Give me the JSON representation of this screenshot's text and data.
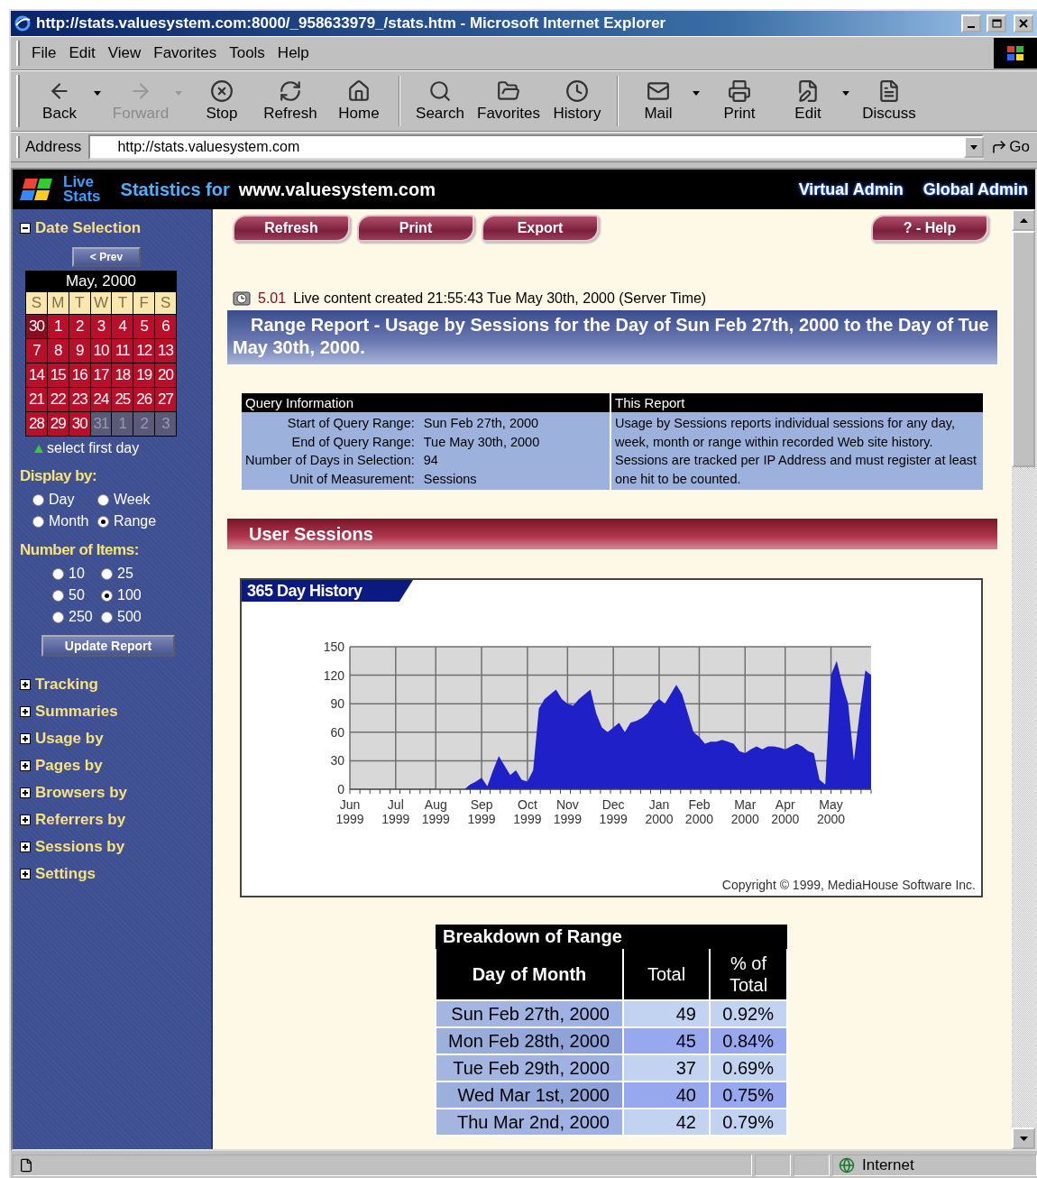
{
  "window": {
    "title": "http://stats.valuesystem.com:8000/_958633979_/stats.htm - Microsoft Internet Explorer"
  },
  "menu": [
    "File",
    "Edit",
    "View",
    "Favorites",
    "Tools",
    "Help"
  ],
  "toolbar_groups": [
    [
      {
        "label": "Back",
        "dropdown": true,
        "disabled": false
      },
      {
        "label": "Forward",
        "dropdown": true,
        "disabled": true
      },
      {
        "label": "Stop",
        "dropdown": false,
        "disabled": false
      },
      {
        "label": "Refresh",
        "dropdown": false,
        "disabled": false
      },
      {
        "label": "Home",
        "dropdown": false,
        "disabled": false
      }
    ],
    [
      {
        "label": "Search",
        "dropdown": false,
        "disabled": false
      },
      {
        "label": "Favorites",
        "dropdown": false,
        "disabled": false
      },
      {
        "label": "History",
        "dropdown": false,
        "disabled": false
      }
    ],
    [
      {
        "label": "Mail",
        "dropdown": true,
        "disabled": false
      },
      {
        "label": "Print",
        "dropdown": false,
        "disabled": false
      },
      {
        "label": "Edit",
        "dropdown": true,
        "disabled": false
      },
      {
        "label": "Discuss",
        "dropdown": false,
        "disabled": false
      }
    ]
  ],
  "address": {
    "label": "Address",
    "value": "http://stats.valuesystem.com",
    "go": "Go"
  },
  "header": {
    "logo": [
      "Live",
      "Stats"
    ],
    "prefix": "Statistics for",
    "site": "www.valuesystem.com",
    "links": [
      "Virtual Admin",
      "Global Admin"
    ]
  },
  "sidebar": {
    "date_selection": {
      "title": "Date Selection",
      "expanded": true,
      "prev": "< Prev",
      "calendar": {
        "title": "May, 2000",
        "weekdays": [
          "S",
          "M",
          "T",
          "W",
          "T",
          "F",
          "S"
        ],
        "weeks": [
          [
            {
              "day": "30",
              "kind": "other"
            },
            {
              "day": "1",
              "kind": "day"
            },
            {
              "day": "2",
              "kind": "day"
            },
            {
              "day": "3",
              "kind": "day"
            },
            {
              "day": "4",
              "kind": "day"
            },
            {
              "day": "5",
              "kind": "day"
            },
            {
              "day": "6",
              "kind": "day"
            }
          ],
          [
            {
              "day": "7",
              "kind": "day"
            },
            {
              "day": "8",
              "kind": "day"
            },
            {
              "day": "9",
              "kind": "day"
            },
            {
              "day": "10",
              "kind": "day"
            },
            {
              "day": "11",
              "kind": "day"
            },
            {
              "day": "12",
              "kind": "day"
            },
            {
              "day": "13",
              "kind": "day"
            }
          ],
          [
            {
              "day": "14",
              "kind": "day"
            },
            {
              "day": "15",
              "kind": "day"
            },
            {
              "day": "16",
              "kind": "day"
            },
            {
              "day": "17",
              "kind": "day"
            },
            {
              "day": "18",
              "kind": "day"
            },
            {
              "day": "19",
              "kind": "day"
            },
            {
              "day": "20",
              "kind": "day"
            }
          ],
          [
            {
              "day": "21",
              "kind": "day"
            },
            {
              "day": "22",
              "kind": "day"
            },
            {
              "day": "23",
              "kind": "day"
            },
            {
              "day": "24",
              "kind": "day"
            },
            {
              "day": "25",
              "kind": "day"
            },
            {
              "day": "26",
              "kind": "day"
            },
            {
              "day": "27",
              "kind": "day"
            }
          ],
          [
            {
              "day": "28",
              "kind": "day"
            },
            {
              "day": "29",
              "kind": "day"
            },
            {
              "day": "30",
              "kind": "day"
            },
            {
              "day": "31",
              "kind": "unavailable"
            },
            {
              "day": "1",
              "kind": "unavailable"
            },
            {
              "day": "2",
              "kind": "unavailable"
            },
            {
              "day": "3",
              "kind": "unavailable"
            }
          ]
        ]
      },
      "hint": "select first day"
    },
    "display_by": {
      "label": "Display by:",
      "options": [
        {
          "label": "Day",
          "selected": false
        },
        {
          "label": "Week",
          "selected": false
        },
        {
          "label": "Month",
          "selected": false
        },
        {
          "label": "Range",
          "selected": true
        }
      ]
    },
    "items": {
      "label": "Number of Items:",
      "options": [
        {
          "label": "10",
          "selected": false
        },
        {
          "label": "25",
          "selected": false
        },
        {
          "label": "50",
          "selected": false
        },
        {
          "label": "100",
          "selected": true
        },
        {
          "label": "250",
          "selected": false
        },
        {
          "label": "500",
          "selected": false
        }
      ]
    },
    "update": "Update Report",
    "sections": [
      {
        "label": "Tracking",
        "expanded": false
      },
      {
        "label": "Summaries",
        "expanded": false
      },
      {
        "label": "Usage by",
        "expanded": false
      },
      {
        "label": "Pages by",
        "expanded": false
      },
      {
        "label": "Browsers by",
        "expanded": false
      },
      {
        "label": "Referrers by",
        "expanded": false
      },
      {
        "label": "Sessions by",
        "expanded": false
      },
      {
        "label": "Settings",
        "expanded": false
      }
    ]
  },
  "actions": [
    "Refresh",
    "Print",
    "Export"
  ],
  "help": "? - Help",
  "info": {
    "version": "5.01",
    "text": "Live content created 21:55:43 Tue May 30th, 2000 (Server Time)"
  },
  "report_title": "Range Report - Usage by Sessions for the Day of Sun Feb 27th, 2000 to the Day of Tue May 30th, 2000.",
  "query": {
    "title": "Query Information",
    "rows": [
      {
        "label": "Start of Query Range:",
        "value": "Sun Feb 27th, 2000"
      },
      {
        "label": "End of Query Range:",
        "value": "Tue May 30th, 2000"
      },
      {
        "label": "Number of Days in Selection:",
        "value": "94"
      },
      {
        "label": "Unit of Measurement:",
        "value": "Sessions"
      }
    ]
  },
  "this_report": {
    "title": "This Report",
    "text": "Usage by Sessions reports individual sessions for any day, week, month or range within recorded Web site history. Sessions are tracked per IP Address and must register at least one hit to be counted."
  },
  "section_title": "User Sessions",
  "history": {
    "tab": "365 Day History",
    "copyright": "Copyright © 1999, MediaHouse Software Inc.",
    "chart_data": {
      "type": "area",
      "grid": true,
      "ylim": [
        0,
        150
      ],
      "yticks": [
        0,
        30,
        60,
        90,
        120,
        150
      ],
      "categories": [
        "Jun 1999",
        null,
        null,
        null,
        null,
        null,
        null,
        null,
        "Jul 1999",
        null,
        null,
        null,
        null,
        null,
        null,
        "Aug 1999",
        null,
        null,
        null,
        null,
        null,
        null,
        null,
        "Sep 1999",
        null,
        null,
        null,
        null,
        null,
        null,
        null,
        "Oct 1999",
        null,
        null,
        null,
        null,
        null,
        null,
        "Nov 1999",
        null,
        null,
        null,
        null,
        null,
        null,
        null,
        "Dec 1999",
        null,
        null,
        null,
        null,
        null,
        null,
        null,
        "Jan 2000",
        null,
        null,
        null,
        null,
        null,
        null,
        "Feb 2000",
        null,
        null,
        null,
        null,
        null,
        null,
        null,
        "Mar 2000",
        null,
        null,
        null,
        null,
        null,
        null,
        "Apr 2000",
        null,
        null,
        null,
        null,
        null,
        null,
        null,
        "May 2000",
        null,
        null,
        null,
        null,
        null,
        null,
        null
      ],
      "series": [
        {
          "color": "#2020c8",
          "values": [
            0,
            0,
            0,
            0,
            0,
            0,
            0,
            0,
            0,
            0,
            0,
            0,
            0,
            0,
            0,
            0,
            0,
            0,
            0,
            0,
            0,
            5,
            8,
            12,
            3,
            20,
            35,
            25,
            15,
            20,
            10,
            8,
            20,
            85,
            95,
            100,
            105,
            95,
            90,
            88,
            95,
            100,
            105,
            80,
            65,
            60,
            65,
            70,
            60,
            70,
            72,
            75,
            80,
            90,
            95,
            90,
            100,
            110,
            100,
            80,
            60,
            55,
            48,
            50,
            50,
            52,
            50,
            48,
            40,
            38,
            42,
            45,
            42,
            45,
            45,
            44,
            42,
            45,
            48,
            45,
            40,
            38,
            10,
            5,
            120,
            135,
            110,
            90,
            30,
            80,
            125,
            120
          ]
        }
      ]
    }
  },
  "breakdown": {
    "title": "Breakdown of Range",
    "columns": [
      "Day of Month",
      "Total",
      "% of Total"
    ],
    "rows": [
      [
        "Sun Feb 27th, 2000",
        "49",
        "0.92%"
      ],
      [
        "Mon Feb 28th, 2000",
        "45",
        "0.84%"
      ],
      [
        "Tue Feb 29th, 2000",
        "37",
        "0.69%"
      ],
      [
        "Wed Mar 1st, 2000",
        "40",
        "0.75%"
      ],
      [
        "Thu Mar 2nd, 2000",
        "42",
        "0.79%"
      ]
    ]
  },
  "status_bar": {
    "zone": "Internet"
  }
}
